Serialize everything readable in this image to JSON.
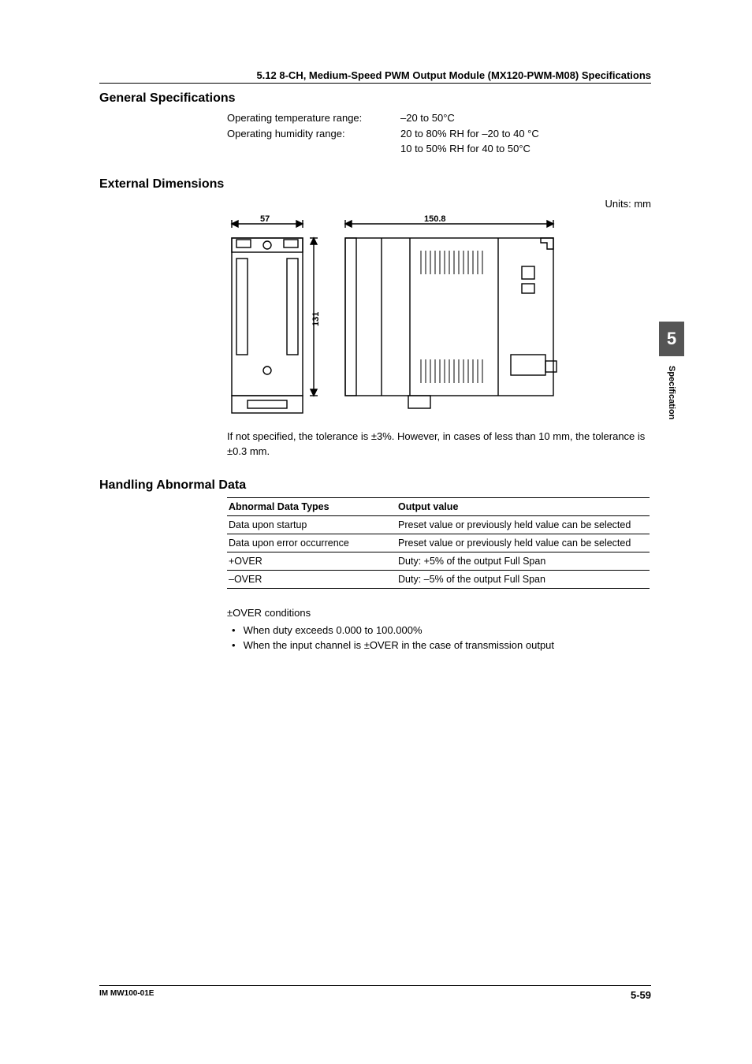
{
  "header": {
    "title": "5.12  8-CH, Medium-Speed PWM Output Module (MX120-PWM-M08) Specifications"
  },
  "sections": {
    "general": {
      "heading": "General Specifications",
      "rows": [
        {
          "label": "Operating temperature range:",
          "value": "–20 to 50°C"
        },
        {
          "label": "Operating humidity range:",
          "value": "20 to 80% RH for –20 to 40 °C"
        },
        {
          "label": "",
          "value": "10 to 50% RH for 40 to 50°C"
        }
      ]
    },
    "dimensions": {
      "heading": "External Dimensions",
      "units": "Units: mm",
      "dims": {
        "width": "57",
        "depth": "150.8",
        "height": "131"
      },
      "tolerance_note": "If not specified, the tolerance is ±3%. However, in cases of less than 10 mm, the tolerance is ±0.3 mm."
    },
    "abnormal": {
      "heading": "Handling Abnormal Data",
      "table": {
        "headers": [
          "Abnormal Data Types",
          "Output value"
        ],
        "rows": [
          [
            "Data upon startup",
            "Preset value or previously held value can be selected"
          ],
          [
            "Data upon error occurrence",
            "Preset value or previously held value can be selected"
          ],
          [
            "+OVER",
            "Duty: +5% of the output Full Span"
          ],
          [
            "–OVER",
            "Duty: –5% of the output Full Span"
          ]
        ]
      },
      "conditions_heading": "±OVER conditions",
      "conditions": [
        "When duty exceeds 0.000 to 100.000%",
        "When the input channel is ±OVER in the case of transmission output"
      ]
    }
  },
  "sidetab": {
    "number": "5",
    "label": "Specification"
  },
  "footer": {
    "left": "IM MW100-01E",
    "right": "5-59"
  },
  "chart_data": {
    "type": "table",
    "title": "Handling Abnormal Data",
    "columns": [
      "Abnormal Data Types",
      "Output value"
    ],
    "rows": [
      [
        "Data upon startup",
        "Preset value or previously held value can be selected"
      ],
      [
        "Data upon error occurrence",
        "Preset value or previously held value can be selected"
      ],
      [
        "+OVER",
        "Duty: +5% of the output Full Span"
      ],
      [
        "–OVER",
        "Duty: –5% of the output Full Span"
      ]
    ]
  }
}
